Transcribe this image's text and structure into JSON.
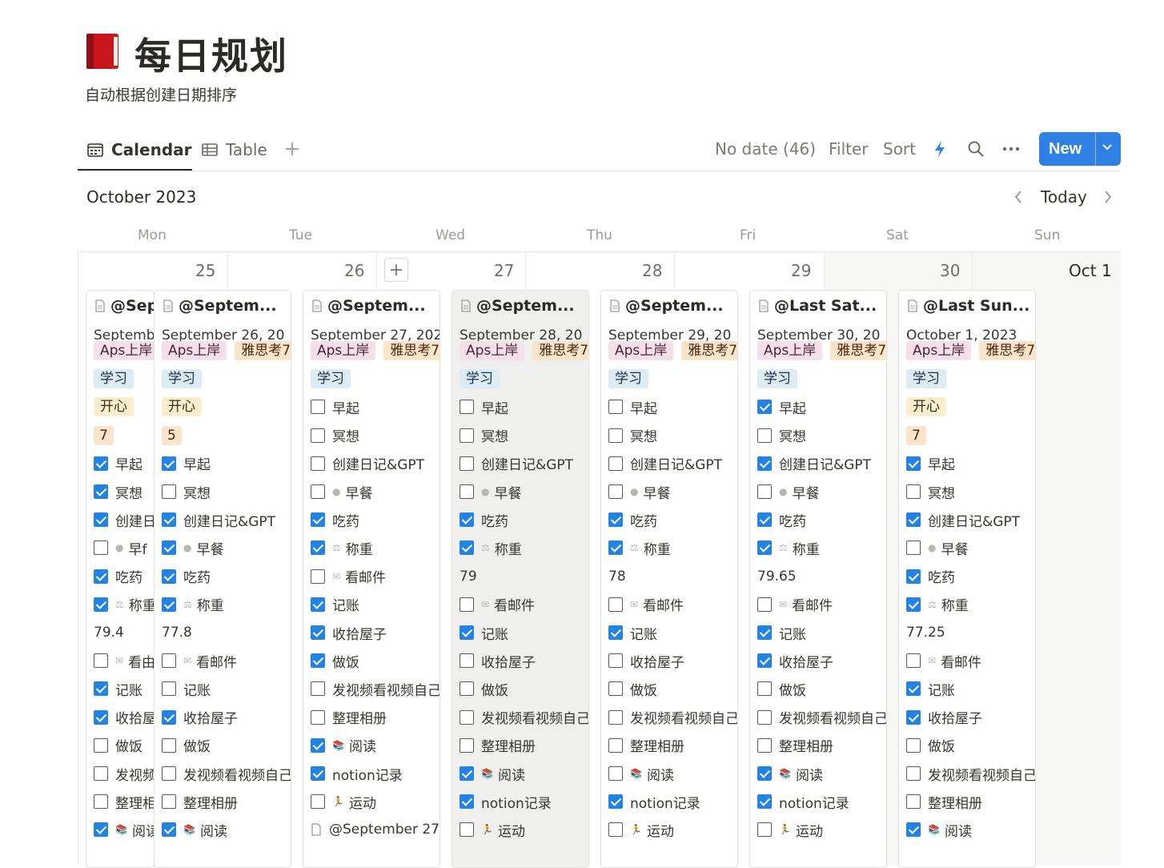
{
  "page": {
    "title": "每日规划",
    "subtitle": "自动根据创建日期排序",
    "title_icon": "red-book-icon"
  },
  "views": {
    "tabs": [
      {
        "label": "Calendar",
        "icon": "calendar-icon",
        "active": true
      },
      {
        "label": "Table",
        "icon": "table-icon",
        "active": false
      }
    ],
    "add_icon": "plus-icon"
  },
  "toolbar": {
    "no_date": "No date (46)",
    "filter": "Filter",
    "sort": "Sort",
    "automation_icon": "lightning-icon",
    "search_icon": "search-icon",
    "more_icon": "more-icon",
    "new_label": "New",
    "accent": "#2f80e4"
  },
  "calendar": {
    "month": "October 2023",
    "today": "Today",
    "weekdays": [
      "Mon",
      "Tue",
      "Wed",
      "Thu",
      "Fri",
      "Sat",
      "Sun"
    ],
    "day_numbers": [
      "25",
      "26",
      "27",
      "28",
      "29",
      "30",
      "Oct 1"
    ],
    "cards": [
      {
        "title": "@Sep",
        "date": "Septemb",
        "rows": [
          {
            "type": "tags",
            "items": [
              {
                "text": "Aps上岸",
                "color": "pink"
              }
            ]
          },
          {
            "type": "tags",
            "items": [
              {
                "text": "学习",
                "color": "blue"
              }
            ]
          },
          {
            "type": "tags",
            "items": [
              {
                "text": "开心",
                "color": "yellow"
              }
            ]
          },
          {
            "type": "tags",
            "items": [
              {
                "text": "7",
                "color": "num"
              }
            ]
          },
          {
            "type": "check",
            "on": true,
            "text": "早起"
          },
          {
            "type": "check",
            "on": true,
            "text": "冥想"
          },
          {
            "type": "check",
            "on": true,
            "text": "创建日"
          },
          {
            "type": "check",
            "on": false,
            "text": "早f",
            "emoji": "●"
          },
          {
            "type": "check",
            "on": true,
            "text": "吃药"
          },
          {
            "type": "check",
            "on": true,
            "text": "称重",
            "emoji": "⚖"
          },
          {
            "type": "value",
            "text": "79.4"
          },
          {
            "type": "check",
            "on": false,
            "text": "看由",
            "emoji": "✉"
          },
          {
            "type": "check",
            "on": true,
            "text": "记账"
          },
          {
            "type": "check",
            "on": true,
            "text": "收拾屋"
          },
          {
            "type": "check",
            "on": false,
            "text": "做饭"
          },
          {
            "type": "check",
            "on": false,
            "text": "发视频"
          },
          {
            "type": "check",
            "on": false,
            "text": "整理相"
          },
          {
            "type": "check",
            "on": true,
            "text": "阅读",
            "emoji": "📚"
          }
        ]
      },
      {
        "title": "@Septem...",
        "date": "September 26, 20",
        "rows": [
          {
            "type": "tags",
            "items": [
              {
                "text": "Aps上岸",
                "color": "pink"
              },
              {
                "text": "雅思考7",
                "color": "orange"
              }
            ]
          },
          {
            "type": "tags",
            "items": [
              {
                "text": "学习",
                "color": "blue"
              }
            ]
          },
          {
            "type": "tags",
            "items": [
              {
                "text": "开心",
                "color": "yellow"
              }
            ]
          },
          {
            "type": "tags",
            "items": [
              {
                "text": "5",
                "color": "num"
              }
            ]
          },
          {
            "type": "check",
            "on": true,
            "text": "早起"
          },
          {
            "type": "check",
            "on": false,
            "text": "冥想"
          },
          {
            "type": "check",
            "on": true,
            "text": "创建日记&GPT"
          },
          {
            "type": "check",
            "on": true,
            "text": "早餐",
            "emoji": "●"
          },
          {
            "type": "check",
            "on": true,
            "text": "吃药"
          },
          {
            "type": "check",
            "on": true,
            "text": "称重",
            "emoji": "⚖"
          },
          {
            "type": "value",
            "text": "77.8"
          },
          {
            "type": "check",
            "on": false,
            "text": "看邮件",
            "emoji": "✉"
          },
          {
            "type": "check",
            "on": false,
            "text": "记账"
          },
          {
            "type": "check",
            "on": true,
            "text": "收拾屋子"
          },
          {
            "type": "check",
            "on": false,
            "text": "做饭"
          },
          {
            "type": "check",
            "on": false,
            "text": "发视频看视频自己"
          },
          {
            "type": "check",
            "on": false,
            "text": "整理相册"
          },
          {
            "type": "check",
            "on": true,
            "text": "阅读",
            "emoji": "📚"
          }
        ]
      },
      {
        "title": "@Septem...",
        "date": "September 27, 202",
        "rows": [
          {
            "type": "tags",
            "items": [
              {
                "text": "Aps上岸",
                "color": "pink"
              },
              {
                "text": "雅思考7",
                "color": "orange"
              }
            ]
          },
          {
            "type": "tags",
            "items": [
              {
                "text": "学习",
                "color": "blue"
              }
            ]
          },
          {
            "type": "check",
            "on": false,
            "text": "早起"
          },
          {
            "type": "check",
            "on": false,
            "text": "冥想"
          },
          {
            "type": "check",
            "on": false,
            "text": "创建日记&GPT"
          },
          {
            "type": "check",
            "on": false,
            "text": "早餐",
            "emoji": "●"
          },
          {
            "type": "check",
            "on": true,
            "text": "吃药"
          },
          {
            "type": "check",
            "on": true,
            "text": "称重",
            "emoji": "⚖"
          },
          {
            "type": "check",
            "on": false,
            "text": "看邮件",
            "emoji": "✉"
          },
          {
            "type": "check",
            "on": true,
            "text": "记账"
          },
          {
            "type": "check",
            "on": true,
            "text": "收拾屋子"
          },
          {
            "type": "check",
            "on": true,
            "text": "做饭"
          },
          {
            "type": "check",
            "on": false,
            "text": "发视频看视频自己"
          },
          {
            "type": "check",
            "on": false,
            "text": "整理相册"
          },
          {
            "type": "check",
            "on": true,
            "text": "阅读",
            "emoji": "📚"
          },
          {
            "type": "check",
            "on": true,
            "text": "notion记录"
          },
          {
            "type": "check",
            "on": false,
            "text": "运动",
            "emoji": "🏃"
          },
          {
            "type": "link",
            "text": "@September 27"
          }
        ]
      },
      {
        "title": "@Septem...",
        "date": "September 28, 20",
        "highlight": true,
        "rows": [
          {
            "type": "tags",
            "items": [
              {
                "text": "Aps上岸",
                "color": "pink"
              },
              {
                "text": "雅思考7",
                "color": "orange"
              }
            ]
          },
          {
            "type": "tags",
            "items": [
              {
                "text": "学习",
                "color": "blue"
              }
            ]
          },
          {
            "type": "check",
            "on": false,
            "text": "早起"
          },
          {
            "type": "check",
            "on": false,
            "text": "冥想"
          },
          {
            "type": "check",
            "on": false,
            "text": "创建日记&GPT"
          },
          {
            "type": "check",
            "on": false,
            "text": "早餐",
            "emoji": "●"
          },
          {
            "type": "check",
            "on": true,
            "text": "吃药"
          },
          {
            "type": "check",
            "on": true,
            "text": "称重",
            "emoji": "⚖"
          },
          {
            "type": "value",
            "text": "79"
          },
          {
            "type": "check",
            "on": false,
            "text": "看邮件",
            "emoji": "✉"
          },
          {
            "type": "check",
            "on": true,
            "text": "记账"
          },
          {
            "type": "check",
            "on": false,
            "text": "收拾屋子"
          },
          {
            "type": "check",
            "on": false,
            "text": "做饭"
          },
          {
            "type": "check",
            "on": false,
            "text": "发视频看视频自己"
          },
          {
            "type": "check",
            "on": false,
            "text": "整理相册"
          },
          {
            "type": "check",
            "on": true,
            "text": "阅读",
            "emoji": "📚"
          },
          {
            "type": "check",
            "on": true,
            "text": "notion记录"
          },
          {
            "type": "check",
            "on": false,
            "text": "运动",
            "emoji": "🏃"
          }
        ]
      },
      {
        "title": "@Septem...",
        "date": "September 29, 20",
        "rows": [
          {
            "type": "tags",
            "items": [
              {
                "text": "Aps上岸",
                "color": "pink"
              },
              {
                "text": "雅思考7",
                "color": "orange"
              }
            ]
          },
          {
            "type": "tags",
            "items": [
              {
                "text": "学习",
                "color": "blue"
              }
            ]
          },
          {
            "type": "check",
            "on": false,
            "text": "早起"
          },
          {
            "type": "check",
            "on": false,
            "text": "冥想"
          },
          {
            "type": "check",
            "on": false,
            "text": "创建日记&GPT"
          },
          {
            "type": "check",
            "on": false,
            "text": "早餐",
            "emoji": "●"
          },
          {
            "type": "check",
            "on": true,
            "text": "吃药"
          },
          {
            "type": "check",
            "on": true,
            "text": "称重",
            "emoji": "⚖"
          },
          {
            "type": "value",
            "text": "78"
          },
          {
            "type": "check",
            "on": false,
            "text": "看邮件",
            "emoji": "✉"
          },
          {
            "type": "check",
            "on": true,
            "text": "记账"
          },
          {
            "type": "check",
            "on": false,
            "text": "收拾屋子"
          },
          {
            "type": "check",
            "on": false,
            "text": "做饭"
          },
          {
            "type": "check",
            "on": false,
            "text": "发视频看视频自己"
          },
          {
            "type": "check",
            "on": false,
            "text": "整理相册"
          },
          {
            "type": "check",
            "on": false,
            "text": "阅读",
            "emoji": "📚"
          },
          {
            "type": "check",
            "on": true,
            "text": "notion记录"
          },
          {
            "type": "check",
            "on": false,
            "text": "运动",
            "emoji": "🏃"
          }
        ]
      },
      {
        "title": "@Last Sat...",
        "date": "September 30, 20",
        "rows": [
          {
            "type": "tags",
            "items": [
              {
                "text": "Aps上岸",
                "color": "pink"
              },
              {
                "text": "雅思考7",
                "color": "orange"
              }
            ]
          },
          {
            "type": "tags",
            "items": [
              {
                "text": "学习",
                "color": "blue"
              }
            ]
          },
          {
            "type": "check",
            "on": true,
            "text": "早起"
          },
          {
            "type": "check",
            "on": false,
            "text": "冥想"
          },
          {
            "type": "check",
            "on": true,
            "text": "创建日记&GPT"
          },
          {
            "type": "check",
            "on": false,
            "text": "早餐",
            "emoji": "●"
          },
          {
            "type": "check",
            "on": true,
            "text": "吃药"
          },
          {
            "type": "check",
            "on": true,
            "text": "称重",
            "emoji": "⚖"
          },
          {
            "type": "value",
            "text": "79.65"
          },
          {
            "type": "check",
            "on": false,
            "text": "看邮件",
            "emoji": "✉"
          },
          {
            "type": "check",
            "on": true,
            "text": "记账"
          },
          {
            "type": "check",
            "on": true,
            "text": "收拾屋子"
          },
          {
            "type": "check",
            "on": false,
            "text": "做饭"
          },
          {
            "type": "check",
            "on": false,
            "text": "发视频看视频自己"
          },
          {
            "type": "check",
            "on": false,
            "text": "整理相册"
          },
          {
            "type": "check",
            "on": true,
            "text": "阅读",
            "emoji": "📚"
          },
          {
            "type": "check",
            "on": true,
            "text": "notion记录"
          },
          {
            "type": "check",
            "on": false,
            "text": "运动",
            "emoji": "🏃"
          }
        ]
      },
      {
        "title": "@Last Sun...",
        "date": "October 1, 2023",
        "rows": [
          {
            "type": "tags",
            "items": [
              {
                "text": "Aps上岸",
                "color": "pink"
              },
              {
                "text": "雅思考7",
                "color": "orange"
              }
            ]
          },
          {
            "type": "tags",
            "items": [
              {
                "text": "学习",
                "color": "blue"
              }
            ]
          },
          {
            "type": "tags",
            "items": [
              {
                "text": "开心",
                "color": "yellow"
              }
            ]
          },
          {
            "type": "tags",
            "items": [
              {
                "text": "7",
                "color": "num"
              }
            ]
          },
          {
            "type": "check",
            "on": true,
            "text": "早起"
          },
          {
            "type": "check",
            "on": false,
            "text": "冥想"
          },
          {
            "type": "check",
            "on": true,
            "text": "创建日记&GPT"
          },
          {
            "type": "check",
            "on": false,
            "text": "早餐",
            "emoji": "●"
          },
          {
            "type": "check",
            "on": true,
            "text": "吃药"
          },
          {
            "type": "check",
            "on": true,
            "text": "称重",
            "emoji": "⚖"
          },
          {
            "type": "value",
            "text": "77.25"
          },
          {
            "type": "check",
            "on": false,
            "text": "看邮件",
            "emoji": "✉"
          },
          {
            "type": "check",
            "on": true,
            "text": "记账"
          },
          {
            "type": "check",
            "on": true,
            "text": "收拾屋子"
          },
          {
            "type": "check",
            "on": false,
            "text": "做饭"
          },
          {
            "type": "check",
            "on": false,
            "text": "发视频看视频自己"
          },
          {
            "type": "check",
            "on": false,
            "text": "整理相册"
          },
          {
            "type": "check",
            "on": true,
            "text": "阅读",
            "emoji": "📚"
          }
        ]
      }
    ]
  }
}
